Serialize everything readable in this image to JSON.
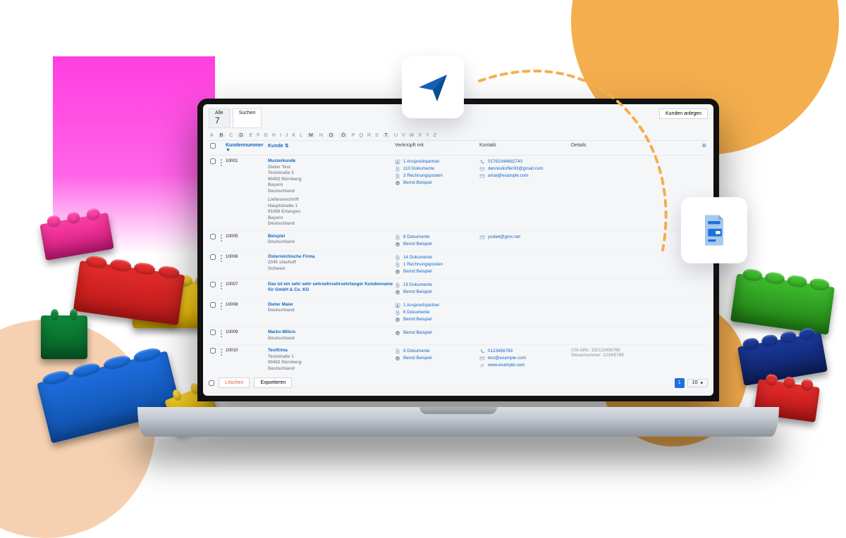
{
  "tabs": {
    "all": "Alle",
    "search": "Suchen",
    "count": "7"
  },
  "create_btn": "Kunden anlegen",
  "alpha": [
    "A",
    "B",
    "C",
    "D",
    "E",
    "F",
    "G",
    "H",
    "I",
    "J",
    "K",
    "L",
    "M",
    "N",
    "O",
    "Ö",
    "P",
    "Q",
    "R",
    "S",
    "T",
    "U",
    "V",
    "W",
    "X",
    "Y",
    "Z"
  ],
  "columns": {
    "num": "Kundennummer ▼",
    "kunde": "Kunde ⇅",
    "verk": "Verknüpft mit",
    "kont": "Kontakt",
    "det": "Details",
    "cfg": "⚙"
  },
  "rows": [
    {
      "num": "10001",
      "kundeName": "Musterkunde",
      "addr": [
        "Dieter Test",
        "Teststraße 3",
        "90402 Nürnberg",
        "Bayern",
        "Deutschland"
      ],
      "addr2_title": "Lieferanschrift",
      "addr2": [
        "Hauptstraße 1",
        "91056 Erlangen",
        "Bayern",
        "Deutschland"
      ],
      "verk": [
        {
          "icon": "person",
          "label": "1 Ansprechpartner"
        },
        {
          "icon": "doc",
          "label": "110 Dokumente"
        },
        {
          "icon": "doc",
          "label": "3 Rechnungsposten"
        },
        {
          "icon": "bb",
          "label": "Bernd Beispiel"
        }
      ],
      "kont": [
        {
          "icon": "phone",
          "label": "01762344682743"
        },
        {
          "icon": "mail",
          "label": "dennisdorfler93@gmail.com"
        },
        {
          "icon": "mail",
          "label": "amal@example.com"
        }
      ],
      "det": []
    },
    {
      "num": "10005",
      "kundeName": "Beispiel",
      "addr": [
        "Deutschland"
      ],
      "verk": [
        {
          "icon": "doc",
          "label": "8 Dokumente"
        },
        {
          "icon": "bb",
          "label": "Bernd Beispiel"
        }
      ],
      "kont": [
        {
          "icon": "mail",
          "label": "yoda4@gmx.net"
        }
      ],
      "det": []
    },
    {
      "num": "10006",
      "kundeName": "Österreichische Firma",
      "addr": [
        "2345 sfasfsdf",
        "Schweiz"
      ],
      "verk": [
        {
          "icon": "doc",
          "label": "14 Dokumente"
        },
        {
          "icon": "doc",
          "label": "1 Rechnungsposten"
        },
        {
          "icon": "bb",
          "label": "Bernd Beispiel"
        }
      ],
      "kont": [],
      "det": []
    },
    {
      "num": "10007",
      "kundeName": "Das ist ein sehr sehr sehrsehrsehrsehrlanger Kundenname für GmbH & Co. KG",
      "addr": [],
      "verk": [
        {
          "icon": "doc",
          "label": "19 Dokumente"
        },
        {
          "icon": "bb",
          "label": "Bernd Beispiel"
        }
      ],
      "kont": [],
      "det": []
    },
    {
      "num": "10008",
      "kundeName": "Dieter Maier",
      "addr": [
        "Deutschland"
      ],
      "verk": [
        {
          "icon": "person",
          "label": "1 Ansprechpartner"
        },
        {
          "icon": "doc",
          "label": "6 Dokumente"
        },
        {
          "icon": "bb",
          "label": "Bernd Beispiel"
        }
      ],
      "kont": [],
      "det": []
    },
    {
      "num": "10009",
      "kundeName": "Marko Milicic",
      "addr": [
        "Deutschland"
      ],
      "verk": [
        {
          "icon": "bb",
          "label": "Bernd Beispiel"
        }
      ],
      "kont": [],
      "det": []
    },
    {
      "num": "10010",
      "kundeName": "Testfirma",
      "addr": [
        "Teststraße 1",
        "90402 Nürnberg",
        "Deutschland"
      ],
      "verk": [
        {
          "icon": "doc",
          "label": "6 Dokumente"
        },
        {
          "icon": "bb",
          "label": "Bernd Beispiel"
        }
      ],
      "kont": [
        {
          "icon": "phone",
          "label": "0123456789"
        },
        {
          "icon": "mail",
          "label": "test@example.com"
        },
        {
          "icon": "web",
          "label": "www.example.com"
        }
      ],
      "det": [
        "USt-IdNr.: DE123456789",
        "Steuernummer: 1234/5789"
      ]
    }
  ],
  "footer": {
    "delete": "Löschen",
    "export": "Exportieren",
    "page": "1",
    "size": "10"
  }
}
